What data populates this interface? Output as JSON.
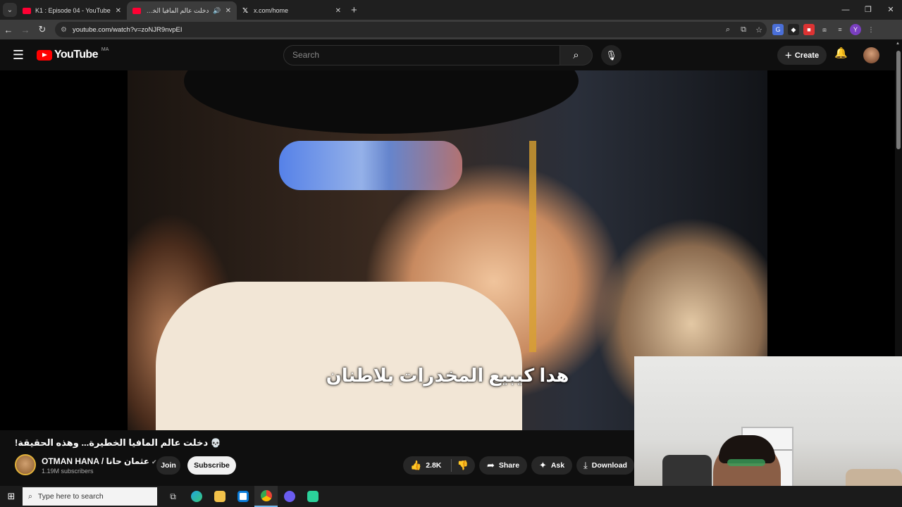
{
  "browser": {
    "tabs": [
      {
        "title": "K1 : Episode 04 - YouTube",
        "favicon": "youtube-icon",
        "active": false
      },
      {
        "title": "دخلت عالم المافيا الخطيرة...",
        "favicon": "youtube-icon",
        "active": true,
        "audio": true
      },
      {
        "title": "x.com/home",
        "favicon": "x-icon",
        "active": false
      }
    ],
    "url": "youtube.com/watch?v=zoNJR9nvpEI",
    "accent": "#3c3c3c"
  },
  "youtube": {
    "logo_text": "YouTube",
    "country_code": "MA",
    "search_placeholder": "Search",
    "create_label": "Create",
    "brand_color": "#ff0000"
  },
  "video": {
    "subtitle": "هدا كيبيع المخدرات بلاطنان",
    "title": "دخلت عالم المافيا الخطيرة... وهذه الحقيقة!",
    "title_emoji": "💀",
    "channel_name": "OTMAN HANA / عثمان حانا",
    "subscribers": "1.19M subscribers",
    "join_label": "Join",
    "subscribe_label": "Subscribe",
    "likes": "2.8K",
    "share_label": "Share",
    "ask_label": "Ask",
    "download_label": "Download"
  },
  "taskbar": {
    "search_placeholder": "Type here to search"
  }
}
